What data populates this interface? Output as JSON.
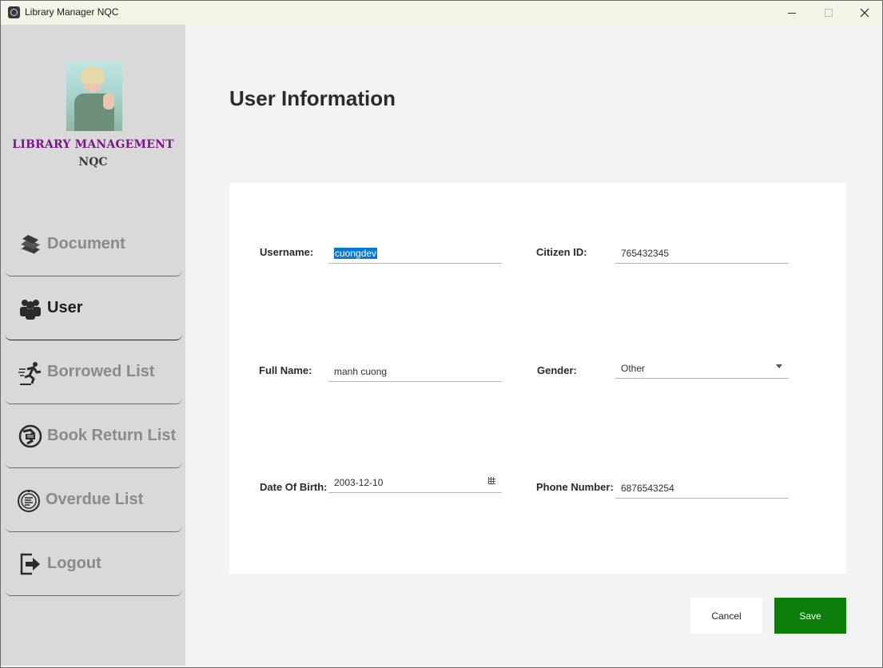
{
  "window": {
    "title": "Library Manager NQC"
  },
  "sidebar": {
    "brand_line1": "LIBRARY MANAGEMENT",
    "brand_line2": "NQC",
    "items": [
      {
        "label": "Document",
        "icon": "book-stack-icon",
        "active": false
      },
      {
        "label": "User",
        "icon": "users-group-icon",
        "active": true
      },
      {
        "label": "Borrowed List",
        "icon": "running-person-icon",
        "active": false
      },
      {
        "label": "Book Return List",
        "icon": "return-globe-icon",
        "active": false
      },
      {
        "label": "Overdue List",
        "icon": "overdue-clock-icon",
        "active": false
      },
      {
        "label": "Logout",
        "icon": "logout-icon",
        "active": false
      }
    ]
  },
  "main": {
    "title": "User Information",
    "form": {
      "username_label": "Username:",
      "username_value": "cuongdev",
      "citizen_id_label": "Citizen ID:",
      "citizen_id_value": "765432345",
      "full_name_label": "Full Name:",
      "full_name_value": "manh cuong",
      "gender_label": "Gender:",
      "gender_value": "Other",
      "dob_label": "Date Of Birth:",
      "dob_value": "2003-12-10",
      "phone_label": "Phone Number:",
      "phone_value": "6876543254"
    },
    "buttons": {
      "cancel": "Cancel",
      "save": "Save"
    }
  },
  "colors": {
    "accent": "#0b7d0b",
    "brand": "#7b1588",
    "selection": "#0078d4"
  }
}
